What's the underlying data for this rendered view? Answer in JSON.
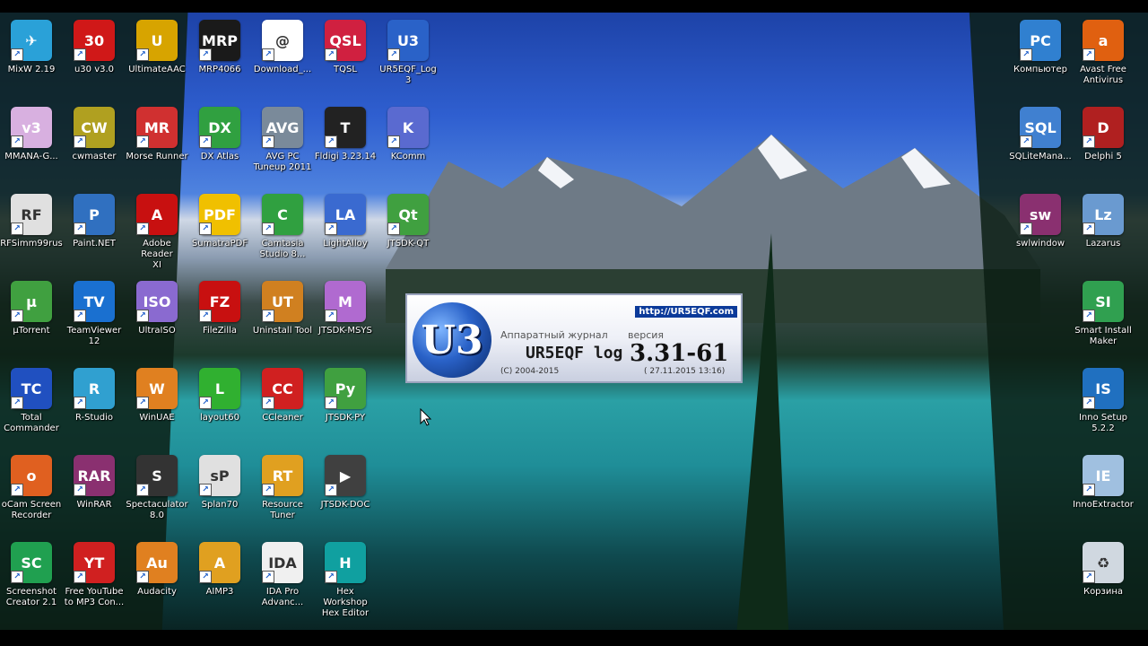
{
  "desktop": {
    "icons": [
      {
        "label": "MixW 2.19",
        "color": "#2aa1d8",
        "glyph": "✈"
      },
      {
        "label": "u30 v3.0",
        "color": "#d01818",
        "glyph": "30"
      },
      {
        "label": "UltimateAAC",
        "color": "#d7a400",
        "glyph": "U"
      },
      {
        "label": "MRP4066",
        "color": "#1a1a1a",
        "glyph": "MRP"
      },
      {
        "label": "Download_...",
        "color": "#ffffff",
        "glyph": "@"
      },
      {
        "label": "TQSL",
        "color": "#d02040",
        "glyph": "QSL"
      },
      {
        "label": "UR5EQF_Log\n3",
        "color": "#2a62c8",
        "glyph": "U3"
      },
      {
        "label": "MMANA-G...",
        "color": "#d8b0e0",
        "glyph": "v3"
      },
      {
        "label": "cwmaster",
        "color": "#b0a020",
        "glyph": "CW"
      },
      {
        "label": "Morse Runner",
        "color": "#d03030",
        "glyph": "MR"
      },
      {
        "label": "DX Atlas",
        "color": "#30a040",
        "glyph": "DX"
      },
      {
        "label": "AVG PC\nTuneup 2011",
        "color": "#7a8a9a",
        "glyph": "AVG"
      },
      {
        "label": "Fldigi 3.23.14",
        "color": "#222222",
        "glyph": "T"
      },
      {
        "label": "KComm",
        "color": "#5a6ad0",
        "glyph": "K"
      },
      {
        "label": "RFSimm99rus",
        "color": "#e0e0e0",
        "glyph": "RF"
      },
      {
        "label": "Paint.NET",
        "color": "#3070c0",
        "glyph": "P"
      },
      {
        "label": "Adobe Reader\nXI",
        "color": "#c81010",
        "glyph": "A"
      },
      {
        "label": "SumatraPDF",
        "color": "#f0c000",
        "glyph": "PDF"
      },
      {
        "label": "Camtasia\nStudio 8...",
        "color": "#30a040",
        "glyph": "C"
      },
      {
        "label": "LightAlloy",
        "color": "#3a6ad0",
        "glyph": "LA"
      },
      {
        "label": "JTSDK-QT",
        "color": "#40a040",
        "glyph": "Qt"
      },
      {
        "label": "µTorrent",
        "color": "#40a040",
        "glyph": "µ"
      },
      {
        "label": "TeamViewer\n12",
        "color": "#1a70d0",
        "glyph": "TV"
      },
      {
        "label": "UltraISO",
        "color": "#8a6ad0",
        "glyph": "ISO"
      },
      {
        "label": "FileZilla",
        "color": "#c81010",
        "glyph": "FZ"
      },
      {
        "label": "Uninstall Tool",
        "color": "#d08020",
        "glyph": "UT"
      },
      {
        "label": "JTSDK-MSYS",
        "color": "#b06ad0",
        "glyph": "M"
      },
      {
        "label": "Total\nCommander",
        "color": "#2050c0",
        "glyph": "TC"
      },
      {
        "label": "R-Studio",
        "color": "#30a0d0",
        "glyph": "R"
      },
      {
        "label": "WinUAE",
        "color": "#e08020",
        "glyph": "W"
      },
      {
        "label": "layout60",
        "color": "#30b030",
        "glyph": "L"
      },
      {
        "label": "CCleaner",
        "color": "#d02020",
        "glyph": "CC"
      },
      {
        "label": "JTSDK-PY",
        "color": "#40a040",
        "glyph": "Py"
      },
      {
        "label": "oCam Screen\nRecorder",
        "color": "#e06020",
        "glyph": "o"
      },
      {
        "label": "WinRAR",
        "color": "#8a3070",
        "glyph": "RAR"
      },
      {
        "label": "Spectaculator\n8.0",
        "color": "#333333",
        "glyph": "S"
      },
      {
        "label": "Splan70",
        "color": "#e0e0e0",
        "glyph": "sP"
      },
      {
        "label": "Resource\nTuner",
        "color": "#e0a020",
        "glyph": "RT"
      },
      {
        "label": "JTSDK-DOC",
        "color": "#404040",
        "glyph": "▶"
      },
      {
        "label": "Screenshot\nCreator 2.1",
        "color": "#20a050",
        "glyph": "SC"
      },
      {
        "label": "Free YouTube\nto MP3 Con...",
        "color": "#d02020",
        "glyph": "YT"
      },
      {
        "label": "Audacity",
        "color": "#e08020",
        "glyph": "Au"
      },
      {
        "label": "AIMP3",
        "color": "#e0a020",
        "glyph": "A"
      },
      {
        "label": "IDA Pro\nAdvanc...",
        "color": "#f0f0f0",
        "glyph": "IDA"
      },
      {
        "label": "Hex Workshop\nHex Editor",
        "color": "#10a0a0",
        "glyph": "H"
      },
      {
        "label": "Компьютер",
        "color": "#3080d0",
        "glyph": "PC"
      },
      {
        "label": "Avast Free\nAntivirus",
        "color": "#e06010",
        "glyph": "a"
      },
      {
        "label": "SQLiteMana...",
        "color": "#4080d0",
        "glyph": "SQL"
      },
      {
        "label": "Delphi 5",
        "color": "#b02020",
        "glyph": "D"
      },
      {
        "label": "swlwindow",
        "color": "#8a3070",
        "glyph": "sw"
      },
      {
        "label": "Lazarus",
        "color": "#6a9ad0",
        "glyph": "Lz"
      },
      {
        "label": "Smart Install\nMaker",
        "color": "#30a050",
        "glyph": "SI"
      },
      {
        "label": "Inno Setup\n5.2.2",
        "color": "#2070c0",
        "glyph": "IS"
      },
      {
        "label": "InnoExtractor",
        "color": "#a0c0e0",
        "glyph": "IE"
      },
      {
        "label": "Корзина",
        "color": "#d0d8e0",
        "glyph": "♻"
      }
    ]
  },
  "splash": {
    "url": "http://UR5EQF.com",
    "logo": "U3",
    "app_desc": "Аппаратный журнал",
    "ver_label": "версия",
    "app_name": "UR5EQF log",
    "version": "3.31-61",
    "copyright": "(C) 2004-2015",
    "build_date": "( 27.11.2015 13:16)"
  }
}
